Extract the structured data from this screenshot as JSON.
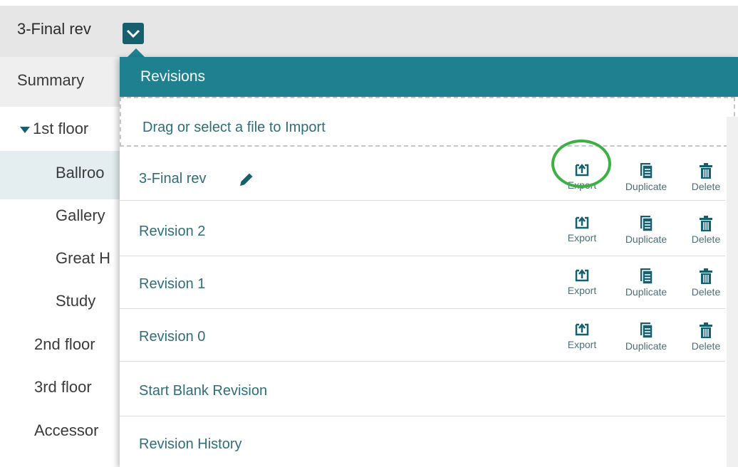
{
  "header": {
    "current_revision": "3-Final rev"
  },
  "tree": {
    "summary": "Summary",
    "items": [
      {
        "label": "1st floor"
      },
      {
        "label": "Ballroo"
      },
      {
        "label": "Gallery"
      },
      {
        "label": "Great H"
      },
      {
        "label": "Study"
      },
      {
        "label": "2nd floor"
      },
      {
        "label": "3rd floor"
      },
      {
        "label": "Accessor"
      }
    ]
  },
  "panel": {
    "title": "Revisions",
    "import_text": "Drag or select a file to Import",
    "revisions": [
      {
        "name": "3-Final rev",
        "editable": true
      },
      {
        "name": "Revision 2"
      },
      {
        "name": "Revision 1"
      },
      {
        "name": "Revision 0"
      }
    ],
    "actions": {
      "export": "Export",
      "duplicate": "Duplicate",
      "delete": "Delete"
    },
    "start_blank": "Start Blank Revision",
    "history": "Revision History"
  },
  "colors": {
    "accent": "#1f8190",
    "dark_accent": "#16606d",
    "link": "#2f6e79",
    "highlight": "#3cb043"
  },
  "icons": {
    "toggle": "chevron-down-icon",
    "edit": "pencil-icon",
    "export": "export-icon",
    "duplicate": "duplicate-icon",
    "delete": "trash-icon"
  }
}
